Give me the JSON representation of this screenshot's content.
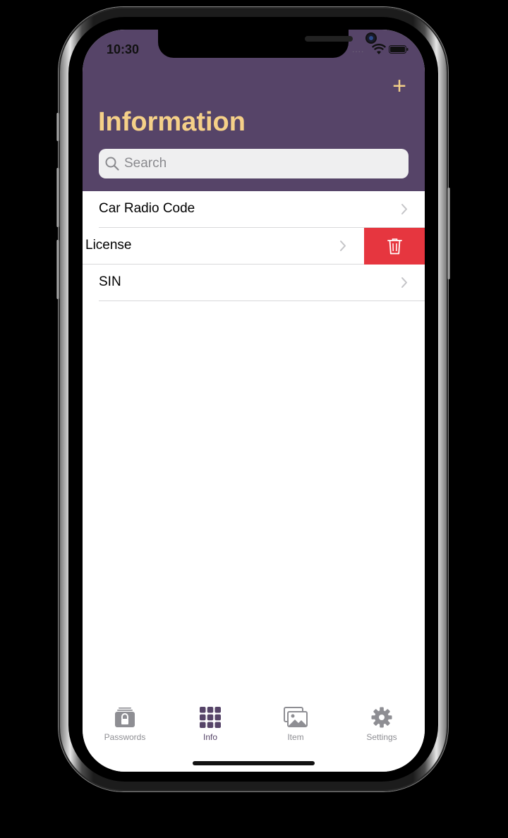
{
  "status_bar": {
    "time": "10:30",
    "signal_dots": "....",
    "wifi": "wifi-icon",
    "battery": "battery-icon"
  },
  "header": {
    "title": "Information",
    "add_label": "+",
    "background": "#564468",
    "title_color": "#f5d088"
  },
  "search": {
    "placeholder": "Search",
    "value": ""
  },
  "list": {
    "items": [
      {
        "label": "Car Radio Code"
      },
      {
        "label": "License",
        "swiped": true
      },
      {
        "label": "SIN"
      }
    ],
    "delete_action": {
      "icon": "trash-icon",
      "color": "#e6363f"
    }
  },
  "tabbar": {
    "tabs": [
      {
        "label": "Passwords",
        "icon": "lock-icon"
      },
      {
        "label": "Info",
        "icon": "grid-icon",
        "active": true
      },
      {
        "label": "Item",
        "icon": "photos-icon"
      },
      {
        "label": "Settings",
        "icon": "gear-icon"
      }
    ],
    "active_color": "#564468",
    "inactive_color": "#8e8e93"
  }
}
